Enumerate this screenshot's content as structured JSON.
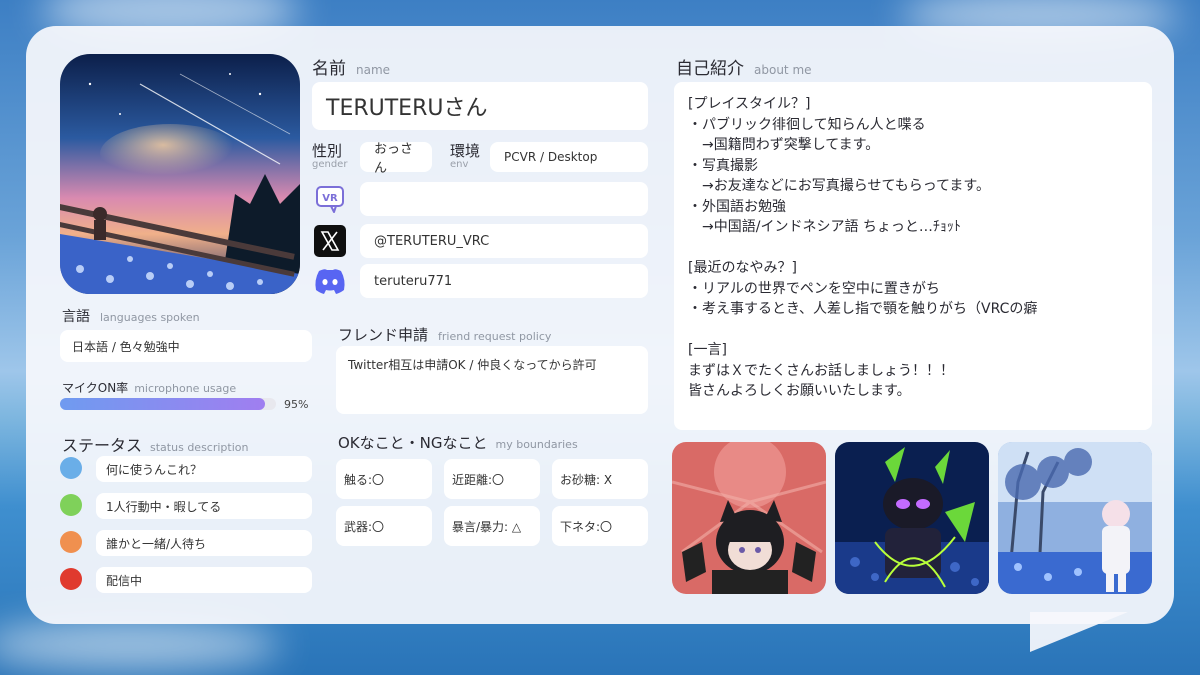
{
  "profile": {
    "name_label_jp": "名前",
    "name_label_en": "name",
    "name": "TERUTERUさん",
    "gender_label_jp": "性別",
    "gender_label_en": "gender",
    "gender": "おっさん",
    "env_label_jp": "環境",
    "env_label_en": "env",
    "env": "PCVR / Desktop",
    "vrchat": "",
    "x_handle": "@TERUTERU_VRC",
    "discord": "teruteru771"
  },
  "languages": {
    "label_jp": "言語",
    "label_en": "languages spoken",
    "value": "日本語 / 色々勉強中"
  },
  "mic": {
    "label_jp": "マイクON率",
    "label_en": "microphone usage",
    "percent_text": "95%",
    "fraction": 0.95
  },
  "status": {
    "label_jp": "ステータス",
    "label_en": "status description",
    "items": [
      {
        "color": "#6aaee8",
        "text": "何に使うんこれ？"
      },
      {
        "color": "#7fd15a",
        "text": "1人行動中・暇してる"
      },
      {
        "color": "#f0904f",
        "text": "誰かと一緒/人待ち"
      },
      {
        "color": "#e03a2e",
        "text": "配信中"
      }
    ]
  },
  "friend": {
    "label_jp": "フレンド申請",
    "label_en": "friend request policy",
    "value": "Twitter相互は申請OK / 仲良くなってから許可"
  },
  "boundaries": {
    "label_jp": "OKなこと・NGなこと",
    "label_en": "my boundaries",
    "items": [
      "触る:〇",
      "近距離:〇",
      "お砂糖: X",
      "武器:〇",
      "暴言/暴力: △",
      "下ネタ:〇"
    ]
  },
  "about": {
    "label_jp": "自己紹介",
    "label_en": "about me",
    "lines": [
      "[プレイスタイル？]",
      "・パブリック徘徊して知らん人と喋る",
      "　→国籍問わず突撃してます。",
      "・写真撮影",
      "　→お友達などにお写真撮らせてもらってます。",
      "・外国語お勉強",
      "　→中国語/インドネシア語 ちょっと…ﾁｮｯﾄ",
      "",
      "[最近のなやみ？]",
      "・リアルの世界でペンを空中に置きがち",
      "・考え事するとき、人差し指で顎を触りがち（VRCの癖",
      "",
      "[一言]",
      "まずはＸでたくさんお話しましょう！！！",
      "皆さんよろしくお願いいたします。"
    ]
  },
  "icons": {
    "vrchat": "vrchat-icon",
    "x": "x-logo-icon",
    "discord": "discord-icon"
  }
}
